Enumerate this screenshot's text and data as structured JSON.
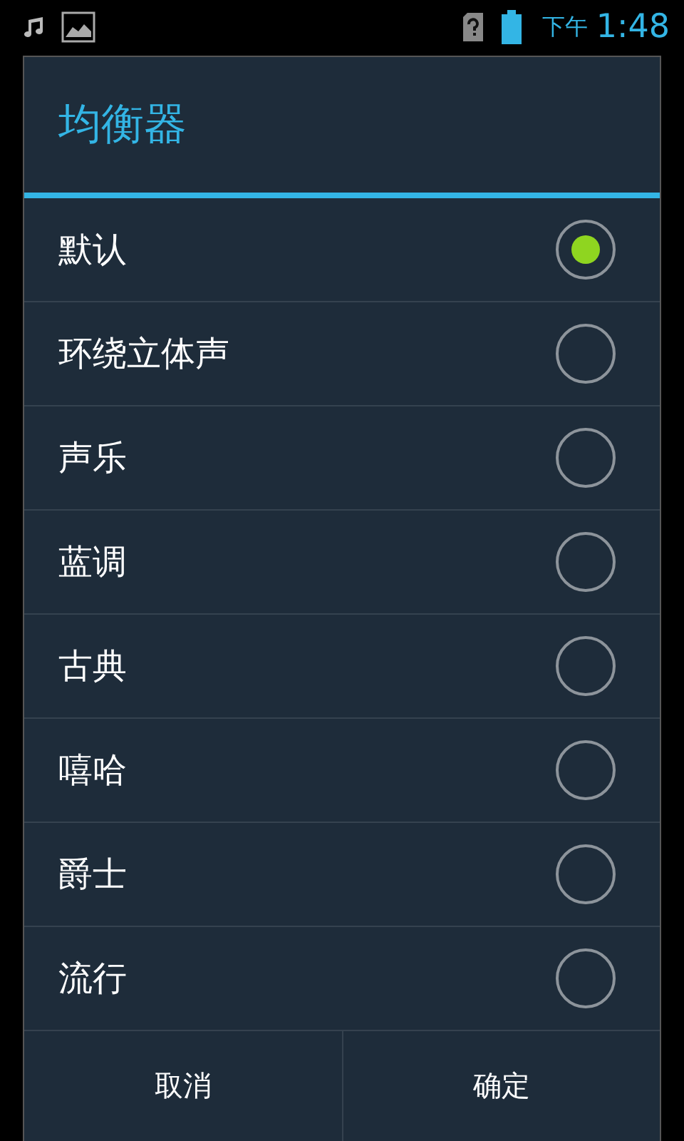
{
  "status_bar": {
    "time_period": "下午",
    "time": "1:48"
  },
  "dialog": {
    "title": "均衡器",
    "options": [
      {
        "label": "默认",
        "selected": true
      },
      {
        "label": "环绕立体声",
        "selected": false
      },
      {
        "label": "声乐",
        "selected": false
      },
      {
        "label": "蓝调",
        "selected": false
      },
      {
        "label": "古典",
        "selected": false
      },
      {
        "label": "嘻哈",
        "selected": false
      },
      {
        "label": "爵士",
        "selected": false
      },
      {
        "label": "流行",
        "selected": false
      }
    ],
    "buttons": [
      "取消",
      "确定"
    ]
  }
}
